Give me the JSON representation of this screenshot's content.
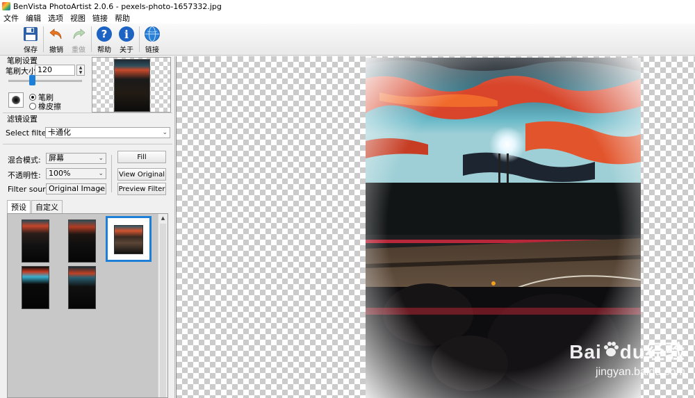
{
  "window": {
    "title": "BenVista PhotoArtist 2.0.6 - pexels-photo-1657332.jpg"
  },
  "menu": [
    "文件",
    "编辑",
    "选项",
    "视图",
    "链接",
    "帮助"
  ],
  "toolbar": {
    "save": "保存",
    "undo": "撤销",
    "redo": "重做",
    "help": "帮助",
    "about": "关于",
    "link": "链接"
  },
  "brush": {
    "section_title": "笔刷设置",
    "size_label": "笔刷大小:",
    "size_value": "120",
    "slider_level": 0.3,
    "mode_brush": "笔刷",
    "mode_eraser": "橡皮擦",
    "selected_mode": "笔刷"
  },
  "filter": {
    "section_title": "滤镜设置",
    "select_label": "Select filter:",
    "select_value": "卡通化",
    "blend_label": "混合模式:",
    "blend_value": "屏幕",
    "opacity_label": "不透明性:",
    "opacity_value": "100%",
    "source_label": "Filter source:",
    "source_value": "Original Image",
    "fill_btn": "Fill",
    "view_original_btn": "View Original",
    "preview_filter_btn": "Preview Filter"
  },
  "tabs": [
    "预设",
    "自定义"
  ],
  "presets": {
    "count": 5,
    "selected_index": 2
  },
  "watermark": {
    "brand_left": "Bai",
    "brand_mid": "du",
    "brand_cn": "经验",
    "url": "jingyan.baidu.com"
  }
}
